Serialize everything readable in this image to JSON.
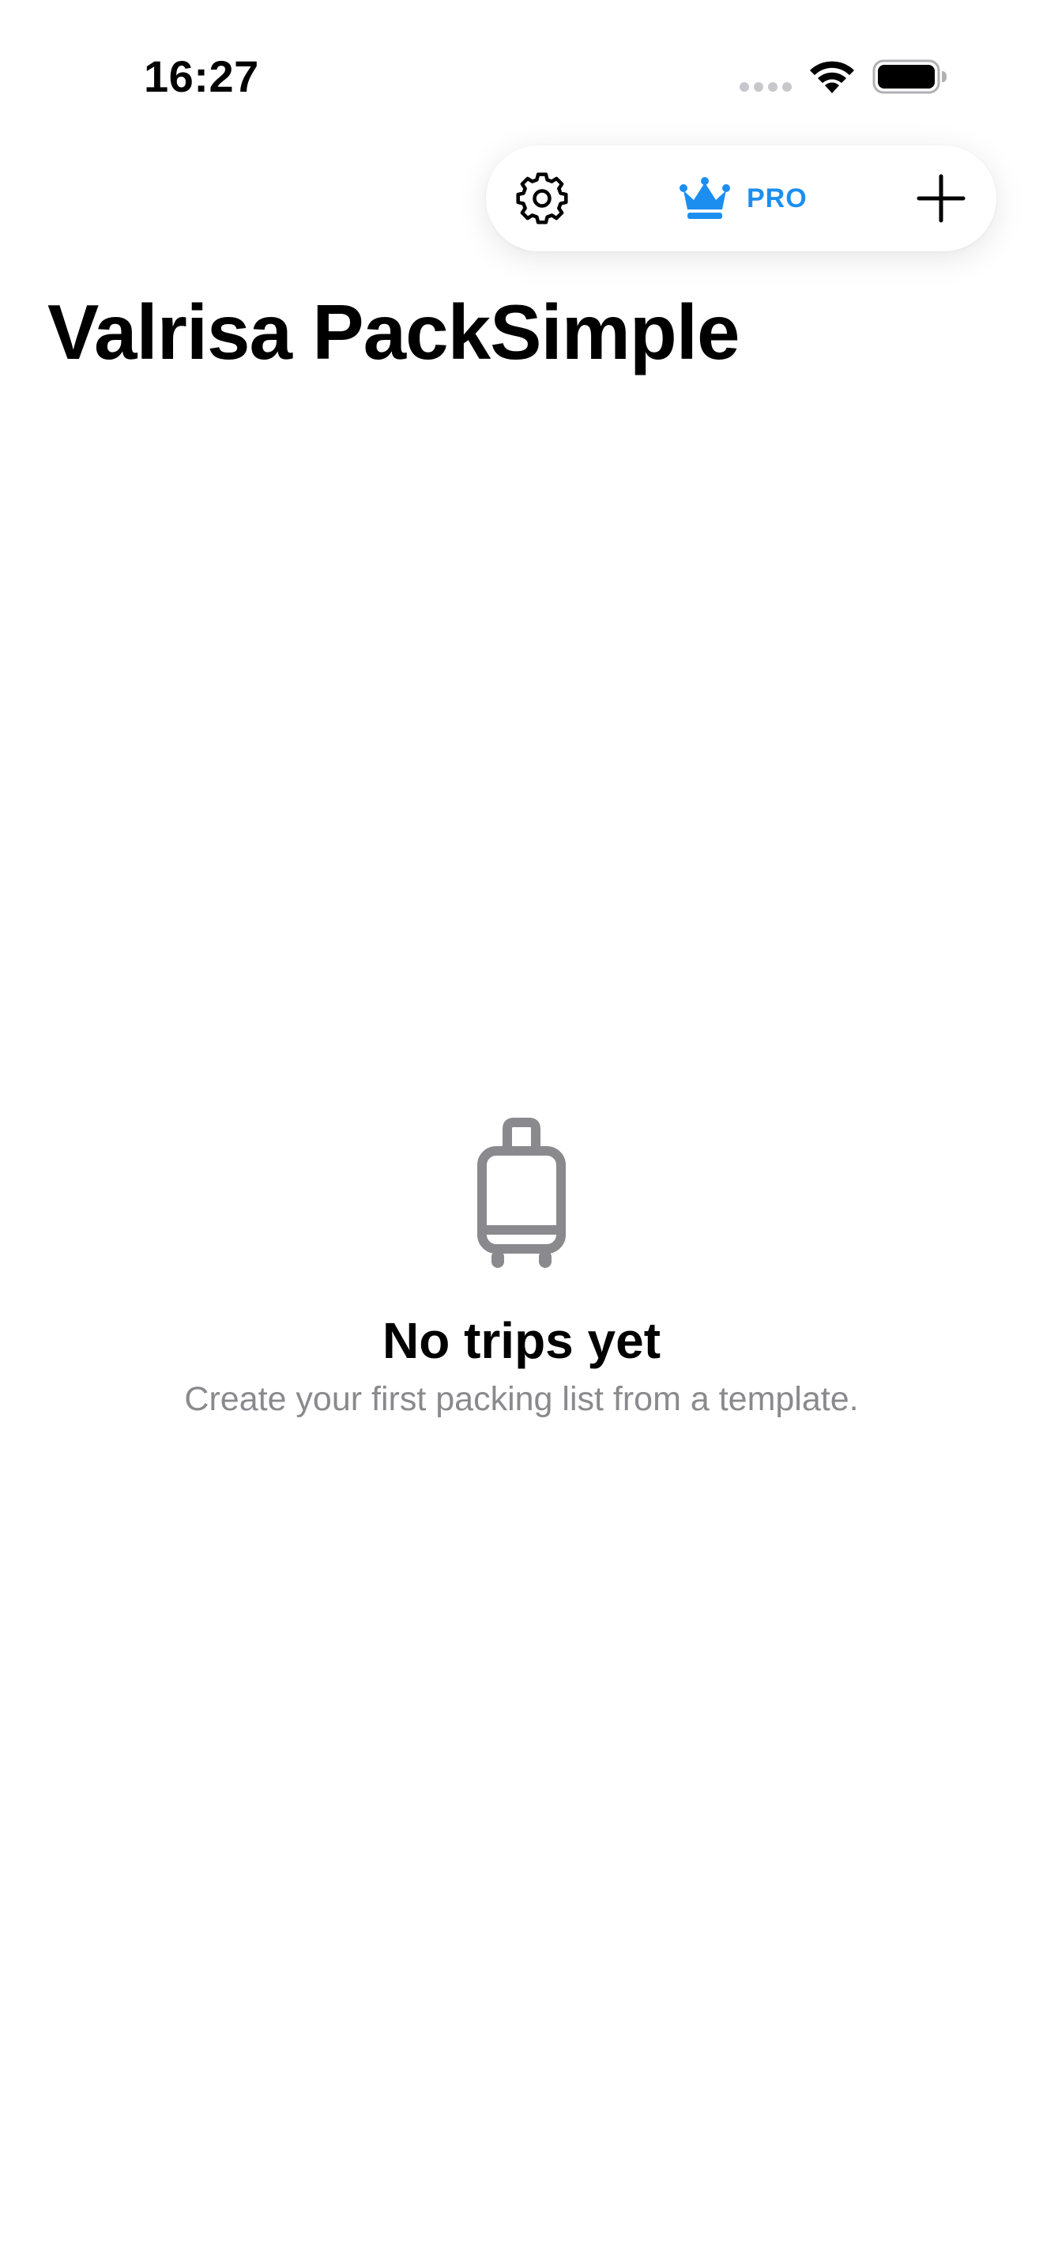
{
  "status_bar": {
    "time": "16:27"
  },
  "toolbar": {
    "settings_icon": "gear-icon",
    "pro_icon": "crown-icon",
    "pro_label": "PRO",
    "add_icon": "plus-icon"
  },
  "header": {
    "title": "Valrisa PackSimple"
  },
  "empty_state": {
    "icon": "suitcase-icon",
    "title": "No trips yet",
    "subtitle": "Create your first packing list from a template."
  },
  "colors": {
    "accent": "#1c8ef0",
    "secondary_text": "#8a8a8e",
    "icon_gray": "#8a8a8e"
  }
}
